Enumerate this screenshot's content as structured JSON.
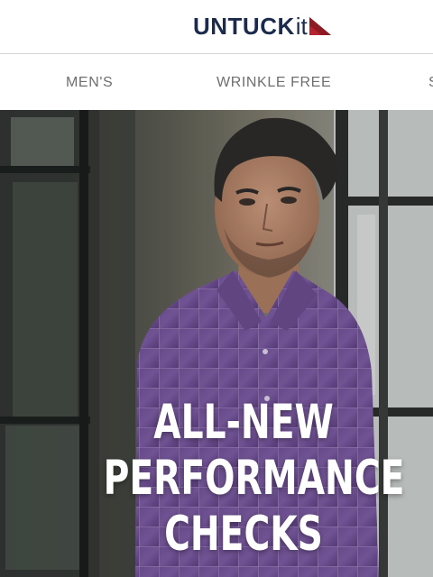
{
  "header": {
    "logo_text_bold": "UNTUCK",
    "logo_text_light": "it",
    "logo_icon": "red-pennant-icon",
    "brand_colors": {
      "navy": "#1c2b4c",
      "red": "#b8222f"
    }
  },
  "nav": {
    "items": [
      {
        "label": "MEN'S"
      },
      {
        "label": "WRINKLE FREE"
      },
      {
        "label": "S"
      }
    ]
  },
  "hero": {
    "headline": [
      "ALL-NEW",
      "PERFORMANCE",
      "CHECKS"
    ],
    "image_subject": "man-in-purple-check-shirt"
  }
}
